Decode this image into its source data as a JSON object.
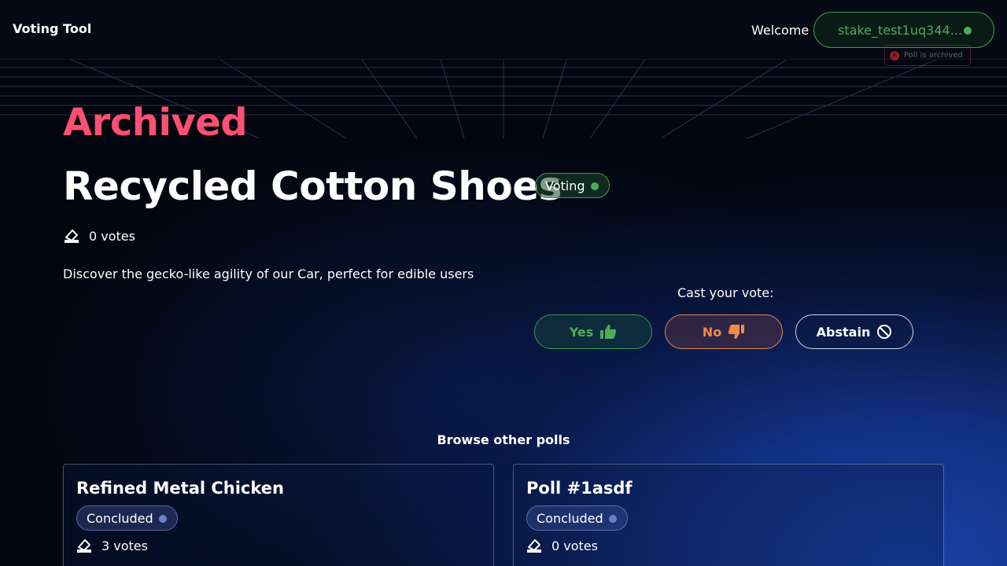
{
  "header": {
    "brand": "Voting Tool",
    "welcome": "Welcome",
    "stake_address": "stake_test1uq344...",
    "toast_text": "Poll is archived"
  },
  "poll": {
    "status_heading": "Archived",
    "title": "Recycled Cotton Shoes",
    "badge": "Voting",
    "votes": "0 votes",
    "description": "Discover the gecko-like agility of our Car, perfect for edible users"
  },
  "vote": {
    "label": "Cast your vote:",
    "yes": "Yes",
    "no": "No",
    "abstain": "Abstain"
  },
  "browse": {
    "heading": "Browse other polls",
    "polls": [
      {
        "title": "Refined Metal Chicken",
        "status": "Concluded",
        "votes": "3 votes"
      },
      {
        "title": "Poll #1asdf",
        "status": "Concluded",
        "votes": "0 votes"
      }
    ]
  },
  "colors": {
    "archived": "#ff4f72",
    "yes": "#4cad56",
    "no": "#ef8b4a",
    "concluded_dot": "#6c80c9"
  },
  "icons": [
    "ballot-box-icon",
    "thumbs-up-icon",
    "thumbs-down-icon",
    "prohibited-icon",
    "close-icon"
  ]
}
